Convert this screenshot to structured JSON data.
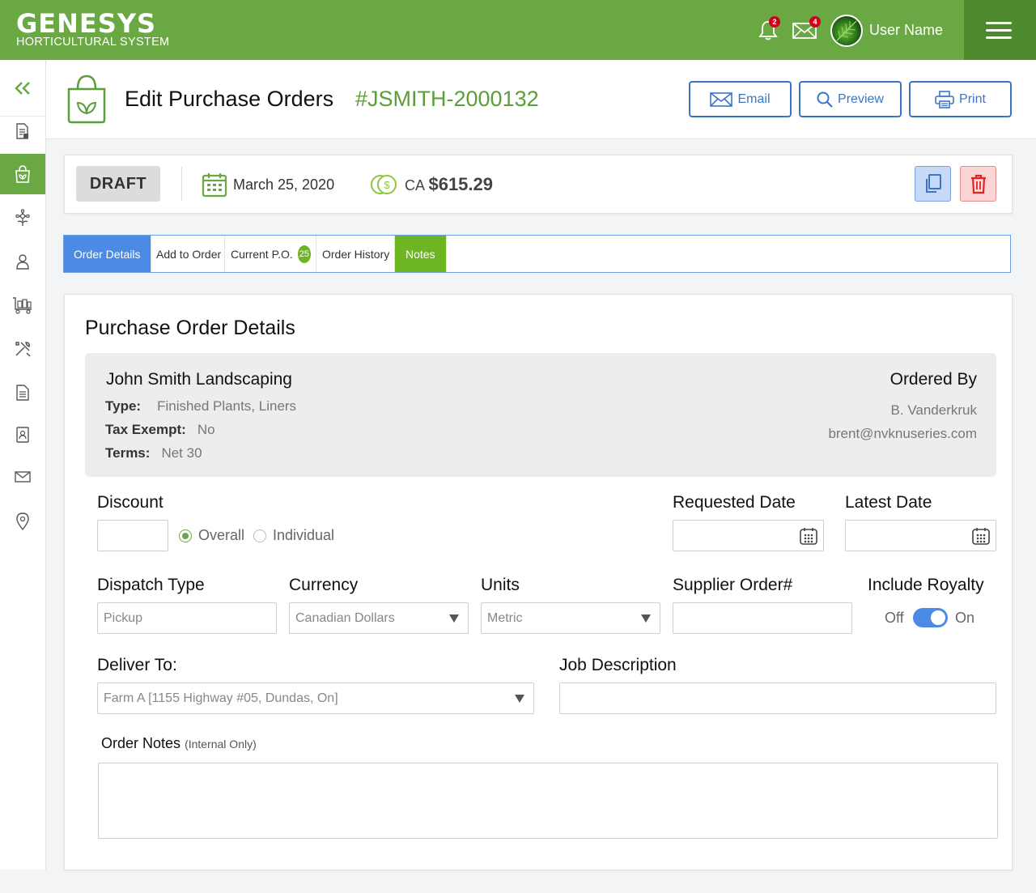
{
  "brand": {
    "name": "GENESYS",
    "subtitle": "HORTICULTURAL SYSTEM"
  },
  "header": {
    "notifications_count": "2",
    "messages_count": "4",
    "user_name": "User Name"
  },
  "page": {
    "title": "Edit Purchase Orders",
    "order_number": "#JSMITH-2000132",
    "buttons": {
      "email": "Email",
      "preview": "Preview",
      "print": "Print"
    }
  },
  "status": {
    "state": "DRAFT",
    "date": "March 25, 2020",
    "currency": "CA",
    "amount": "$615.29"
  },
  "tabs": [
    {
      "label": "Order Details",
      "active": true
    },
    {
      "label": "Add to Order"
    },
    {
      "label": "Current P.O.",
      "badge": "25"
    },
    {
      "label": "Order History"
    },
    {
      "label": "Notes"
    }
  ],
  "details": {
    "section_title": "Purchase Order Details",
    "company": "John Smith Landscaping",
    "type_label": "Type:",
    "type_value": "Finished Plants, Liners",
    "tax_label": "Tax Exempt:",
    "tax_value": "No",
    "terms_label": "Terms:",
    "terms_value": "Net 30",
    "ordered_by_label": "Ordered By",
    "ordered_by_name": "B. Vanderkruk",
    "ordered_by_email": "brent@nvknuseries.com"
  },
  "form": {
    "discount_label": "Discount",
    "discount_value": "",
    "discount_options": [
      "Overall",
      "Individual"
    ],
    "discount_selected": "Overall",
    "requested_date_label": "Requested Date",
    "latest_date_label": "Latest Date",
    "dispatch_label": "Dispatch Type",
    "dispatch_placeholder": "Pickup",
    "currency_label": "Currency",
    "currency_value": "Canadian Dollars",
    "units_label": "Units",
    "units_value": "Metric",
    "supplier_order_label": "Supplier Order#",
    "royalty_label": "Include Royalty",
    "royalty_off": "Off",
    "royalty_on": "On",
    "royalty_enabled": true,
    "deliver_to_label": "Deliver To:",
    "deliver_to_value": "Farm A [1155 Highway #05, Dundas, On]",
    "job_description_label": "Job Description",
    "order_notes_label": "Order Notes",
    "order_notes_hint": "(Internal Only)"
  },
  "colors": {
    "brand_green": "#6aa843",
    "dark_green": "#4d8a2d",
    "accent_blue": "#4b8be6",
    "notes_green": "#6eb523",
    "danger_red": "#e02424"
  }
}
